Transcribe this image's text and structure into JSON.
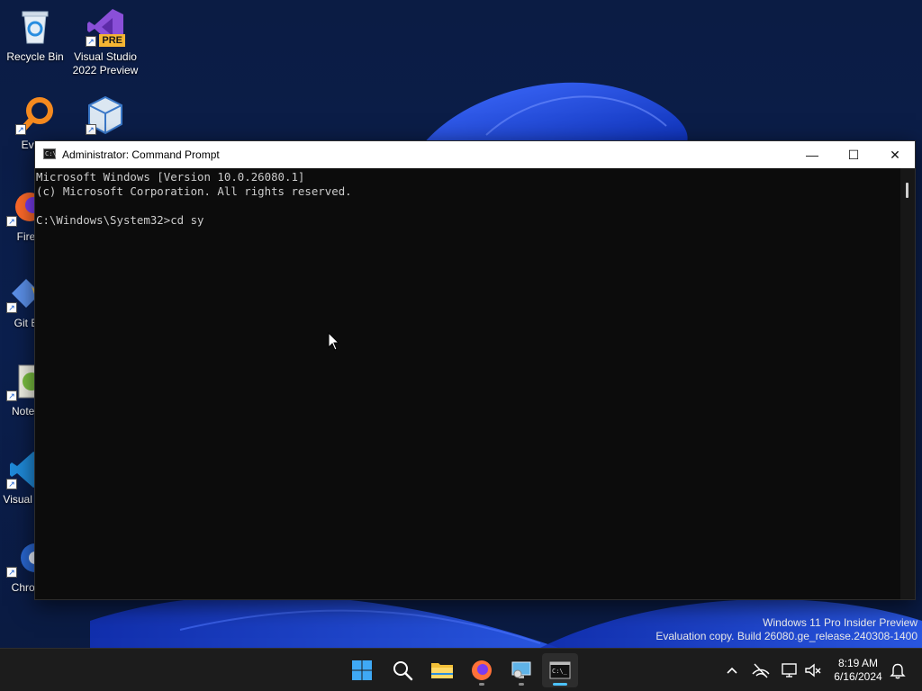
{
  "desktop": {
    "icons": [
      {
        "label": "Recycle Bin"
      },
      {
        "label": "Visual Studio 2022 Preview",
        "badge": "PRE"
      },
      {
        "label": "Every"
      },
      {
        "label": ""
      },
      {
        "label": "Fire"
      },
      {
        "label": "Git E"
      },
      {
        "label": "Notep"
      },
      {
        "label": "Visual Co"
      },
      {
        "label": "Chron"
      }
    ]
  },
  "window": {
    "title": "Administrator: Command Prompt",
    "icon_text": "C:\\",
    "buttons": {
      "minimize": "—",
      "maximize": "☐",
      "close": "✕"
    },
    "console_text": "Microsoft Windows [Version 10.0.26080.1]\n(c) Microsoft Corporation. All rights reserved.\n\nC:\\Windows\\System32>cd sy"
  },
  "watermark": {
    "line1": "Windows 11 Pro Insider Preview",
    "line2": "Evaluation copy. Build 26080.ge_release.240308-1400"
  },
  "taskbar": {
    "items": [
      {
        "name": "start-icon"
      },
      {
        "name": "search-icon"
      },
      {
        "name": "file-explorer-icon"
      },
      {
        "name": "firefox-icon"
      },
      {
        "name": "remote-desktop-icon"
      },
      {
        "name": "command-prompt-icon",
        "active": true
      }
    ],
    "tray": [
      "chevron-up-icon",
      "network-offline-icon",
      "display-icon",
      "volume-muted-icon",
      "notification-bell-icon"
    ],
    "clock": {
      "time": "8:19 AM",
      "date": "6/16/2024"
    }
  },
  "colors": {
    "console_bg": "#0c0c0c",
    "console_fg": "#cccccc",
    "titlebar_bg": "#ffffff",
    "taskbar_bg": "#1c1c1c"
  }
}
